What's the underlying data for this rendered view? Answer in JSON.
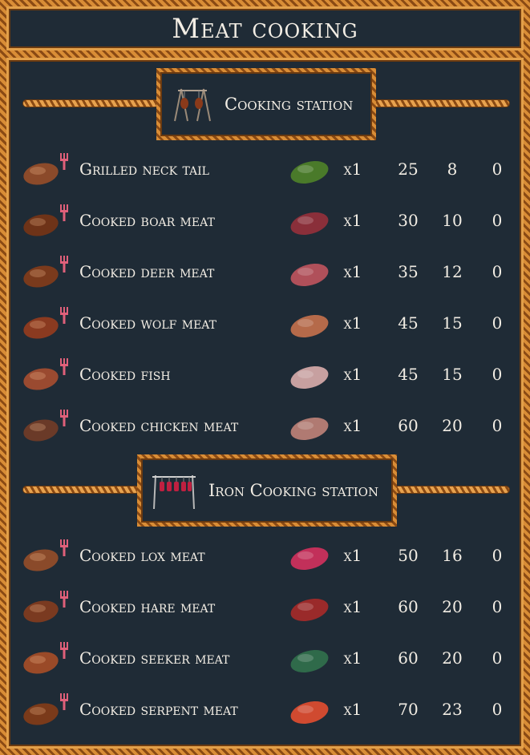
{
  "title": "Meat cooking",
  "sections": [
    {
      "station": "Cooking station",
      "station_icon": "cooking-station-icon",
      "rows": [
        {
          "name": "Grilled neck tail",
          "qty": "x1",
          "v1": "25",
          "v2": "8",
          "v3": "0",
          "color": "#8b4a2a",
          "raw_color": "#4a7a2a"
        },
        {
          "name": "Cooked boar meat",
          "qty": "x1",
          "v1": "30",
          "v2": "10",
          "v3": "0",
          "color": "#6e3318",
          "raw_color": "#8a2f3a"
        },
        {
          "name": "Cooked deer meat",
          "qty": "x1",
          "v1": "35",
          "v2": "12",
          "v3": "0",
          "color": "#7a3a1c",
          "raw_color": "#b0505a"
        },
        {
          "name": "Cooked wolf meat",
          "qty": "x1",
          "v1": "45",
          "v2": "15",
          "v3": "0",
          "color": "#8a3a20",
          "raw_color": "#b56a4a"
        },
        {
          "name": "Cooked fish",
          "qty": "x1",
          "v1": "45",
          "v2": "15",
          "v3": "0",
          "color": "#9a4a30",
          "raw_color": "#c7a0a0"
        },
        {
          "name": "Cooked chicken meat",
          "qty": "x1",
          "v1": "60",
          "v2": "20",
          "v3": "0",
          "color": "#6a3a28",
          "raw_color": "#b07a72"
        }
      ]
    },
    {
      "station": "Iron Cooking station",
      "station_icon": "iron-cooking-station-icon",
      "rows": [
        {
          "name": "Cooked lox meat",
          "qty": "x1",
          "v1": "50",
          "v2": "16",
          "v3": "0",
          "color": "#8a4a2a",
          "raw_color": "#c2305a"
        },
        {
          "name": "Cooked hare meat",
          "qty": "x1",
          "v1": "60",
          "v2": "20",
          "v3": "0",
          "color": "#7a3a20",
          "raw_color": "#9a2a2a"
        },
        {
          "name": "Cooked seeker meat",
          "qty": "x1",
          "v1": "60",
          "v2": "20",
          "v3": "0",
          "color": "#9a4a28",
          "raw_color": "#2f6a4a"
        },
        {
          "name": "Cooked serpent meat",
          "qty": "x1",
          "v1": "70",
          "v2": "23",
          "v3": "0",
          "color": "#7a3a1a",
          "raw_color": "#d04a30"
        }
      ]
    }
  ]
}
